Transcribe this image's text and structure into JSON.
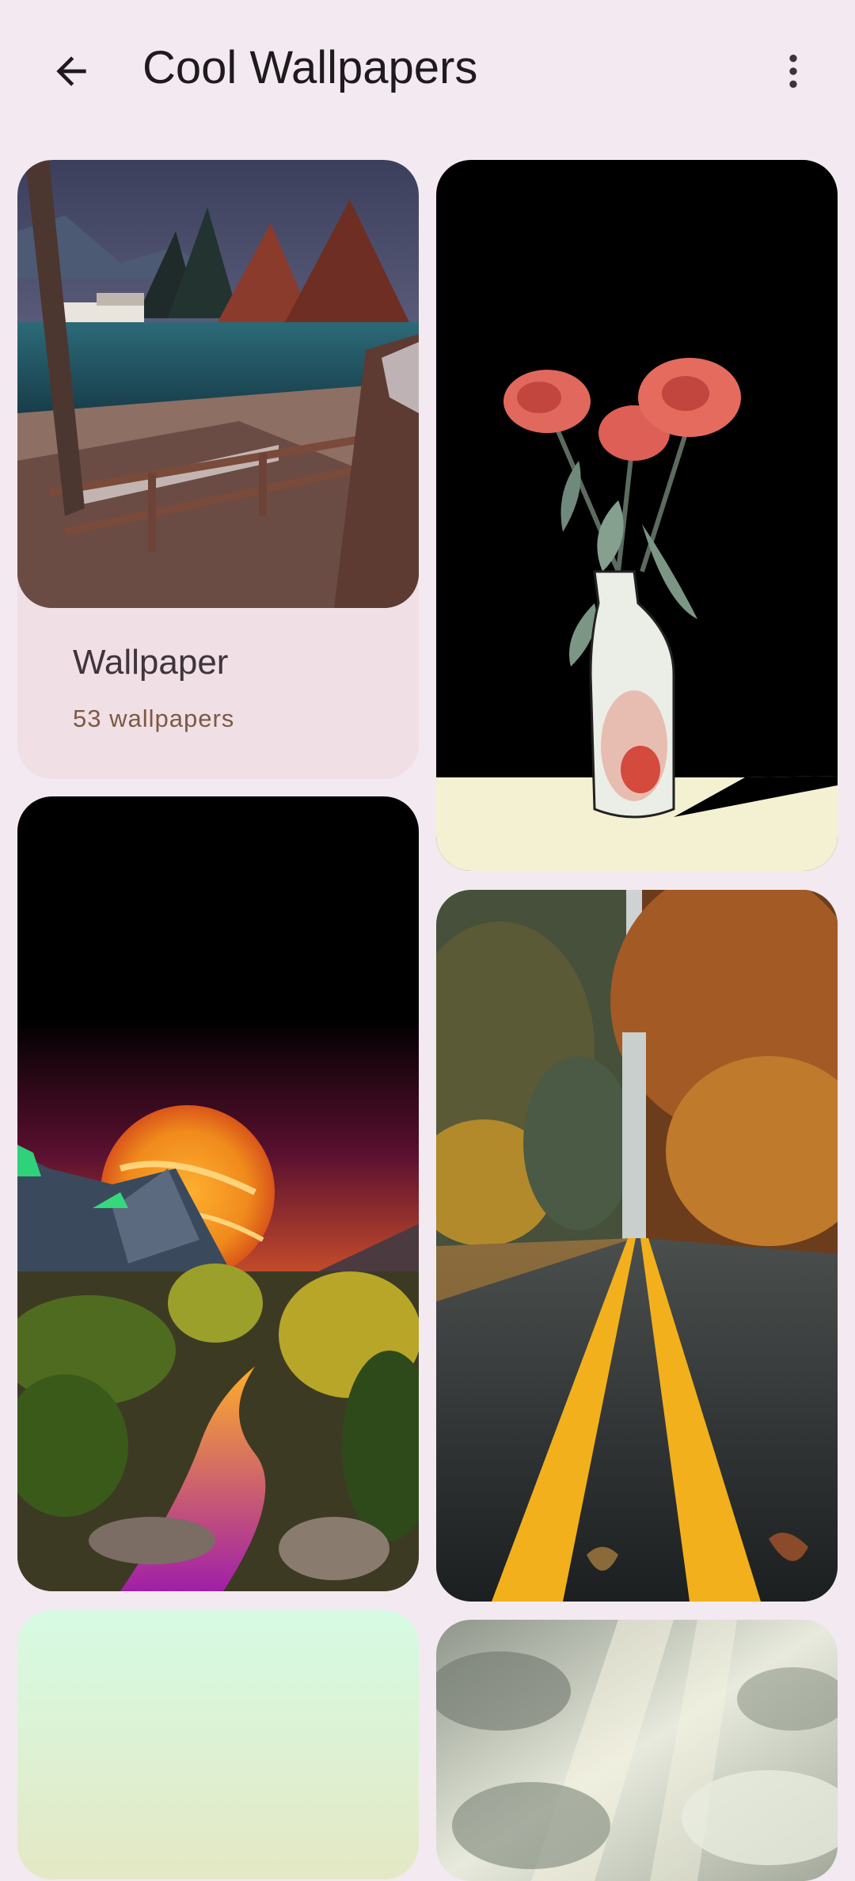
{
  "app_bar": {
    "title": "Cool Wallpapers",
    "back_icon": "arrow-back-icon",
    "more_icon": "more-vert-icon"
  },
  "collections": [
    {
      "title": "Wallpaper",
      "count_label": "53 wallpapers"
    }
  ],
  "colors": {
    "background": "#f3e9f0",
    "caption_card": "#f0dfe5",
    "title_text": "#1f1a1e",
    "subtitle_text": "#7b5a45"
  }
}
